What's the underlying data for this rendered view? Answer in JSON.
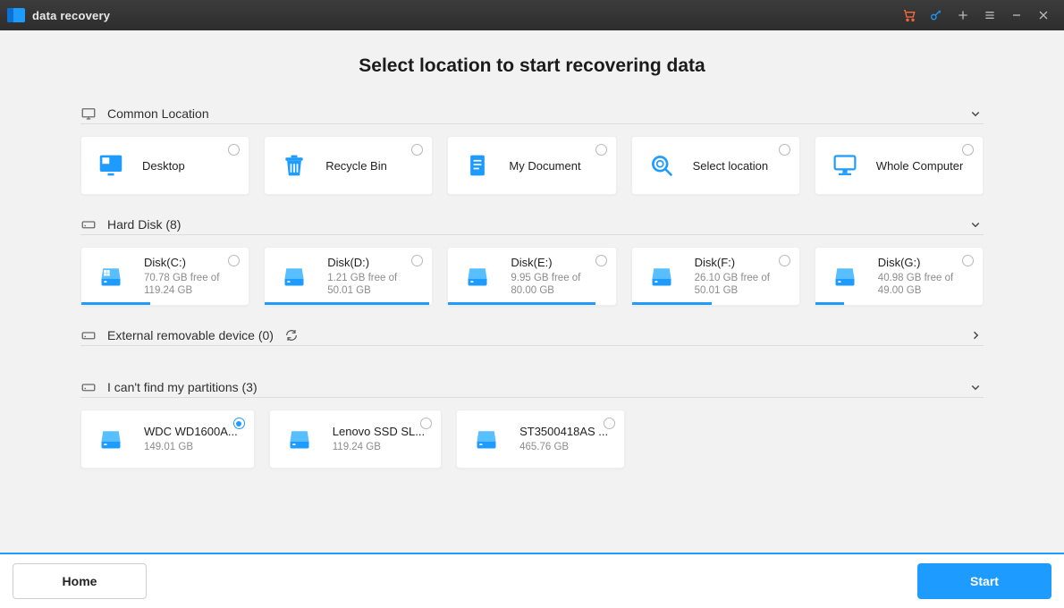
{
  "app": {
    "title": "data recovery"
  },
  "page_title": "Select location to start recovering data",
  "sections": {
    "common": {
      "label": "Common Location"
    },
    "hard_disk": {
      "label": "Hard Disk (8)"
    },
    "external": {
      "label": "External removable device (0)"
    },
    "lost": {
      "label": "I can't find my partitions (3)"
    }
  },
  "common_locations": [
    {
      "label": "Desktop",
      "icon": "desktop"
    },
    {
      "label": "Recycle Bin",
      "icon": "recyclebin"
    },
    {
      "label": "My Document",
      "icon": "document"
    },
    {
      "label": "Select location",
      "icon": "search"
    },
    {
      "label": "Whole Computer",
      "icon": "computer"
    }
  ],
  "disks": [
    {
      "label": "Disk(C:)",
      "info": "70.78 GB  free of 119.24 GB",
      "used_pct": 41
    },
    {
      "label": "Disk(D:)",
      "info": "1.21 GB  free of 50.01 GB",
      "used_pct": 98
    },
    {
      "label": "Disk(E:)",
      "info": "9.95 GB  free of 80.00 GB",
      "used_pct": 88
    },
    {
      "label": "Disk(F:)",
      "info": "26.10 GB  free of 50.01 GB",
      "used_pct": 48
    },
    {
      "label": "Disk(G:)",
      "info": "40.98 GB  free of 49.00 GB",
      "used_pct": 17
    }
  ],
  "lost_partitions": [
    {
      "label": "WDC WD1600A...",
      "info": "149.01 GB",
      "selected": true
    },
    {
      "label": "Lenovo SSD SL...",
      "info": "119.24 GB",
      "selected": false
    },
    {
      "label": "ST3500418AS ...",
      "info": "465.76 GB",
      "selected": false
    }
  ],
  "footer": {
    "home": "Home",
    "start": "Start"
  }
}
